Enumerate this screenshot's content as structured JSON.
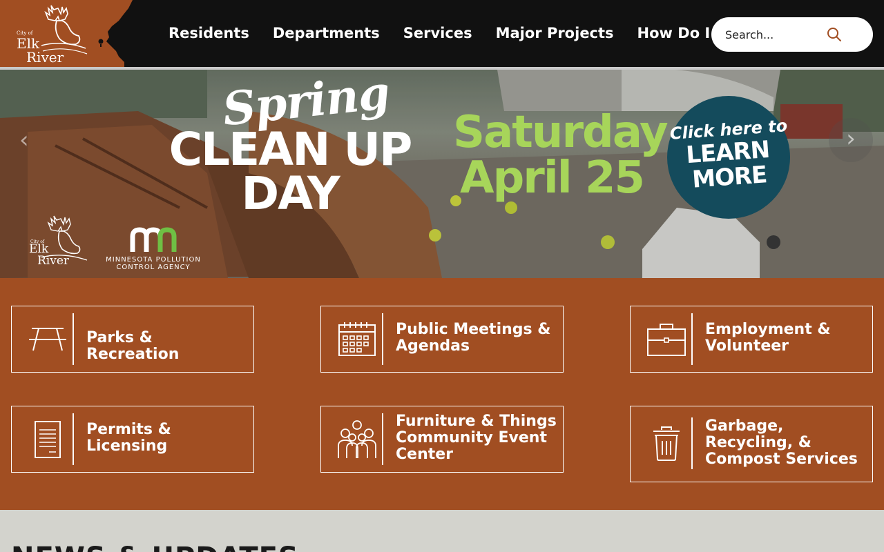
{
  "header": {
    "logo": {
      "city_of": "City of",
      "elk": "Elk",
      "river": "River"
    },
    "nav": [
      {
        "label": "Residents"
      },
      {
        "label": "Departments"
      },
      {
        "label": "Services"
      },
      {
        "label": "Major Projects"
      },
      {
        "label": "How Do I"
      }
    ],
    "search": {
      "placeholder": "Search..."
    }
  },
  "hero": {
    "spring": "Spring",
    "cleanup_line1": "CLEAN UP",
    "cleanup_line2": "DAY",
    "date_line1": "Saturday",
    "date_line2": "April 25",
    "cta_line1": "Click here to",
    "cta_line2": "LEARN",
    "cta_line3": "MORE",
    "mpca_line1": "MINNESOTA POLLUTION",
    "mpca_line2": "CONTROL AGENCY",
    "logo": {
      "city_of": "City of",
      "elk": "Elk",
      "river": "River"
    },
    "prev_arrow": "‹",
    "next_arrow": "›"
  },
  "quick_links": [
    {
      "label": "Parks & Recreation",
      "icon": "picnic-table-icon"
    },
    {
      "label": "Public Meetings & Agendas",
      "icon": "calendar-icon"
    },
    {
      "label": "Employment & Volunteer",
      "icon": "briefcase-icon"
    },
    {
      "label": "Permits & Licensing",
      "icon": "document-icon"
    },
    {
      "label": "Furniture & Things Community Event Center",
      "icon": "people-group-icon"
    },
    {
      "label": "Garbage, Recycling, & Compost Services",
      "icon": "trash-can-icon"
    }
  ],
  "news": {
    "title": "NEWS & UPDATES"
  },
  "colors": {
    "header_bg": "#111111",
    "brand_orange": "#a14e22",
    "hero_green": "#a7d55a",
    "cta_teal": "#144b5c",
    "news_bg": "#d3d3cd"
  }
}
